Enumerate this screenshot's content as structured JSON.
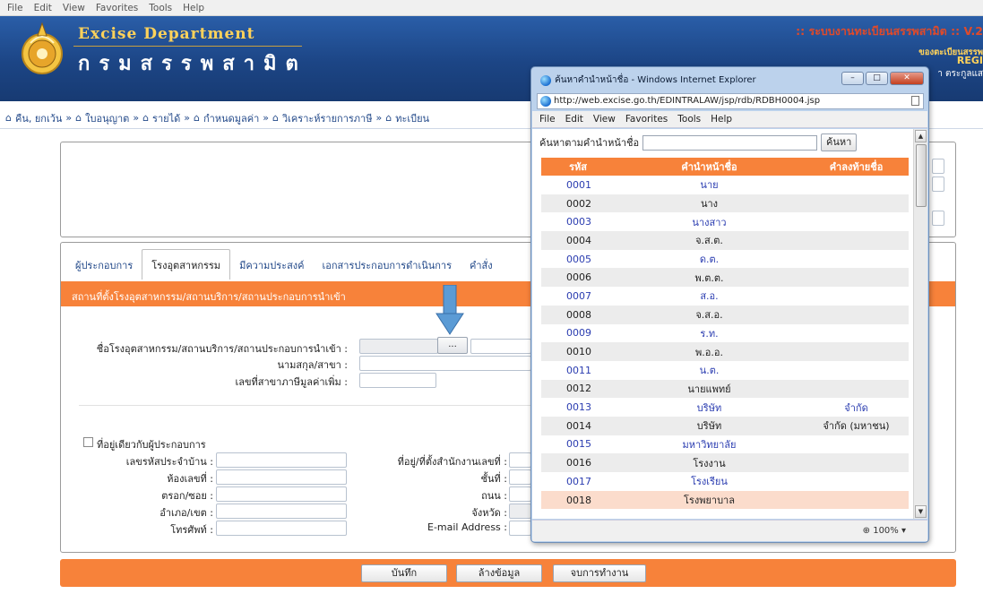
{
  "browser_menu": [
    "File",
    "Edit",
    "View",
    "Favorites",
    "Tools",
    "Help"
  ],
  "header": {
    "brand_en": "Excise Department",
    "brand_th": "กรมสรรพสามิต",
    "system_title": ":: ระบบงานทะเบียนสรรพสามิต :: V.2",
    "sub1": "ของตะเบียนสรรพ",
    "sub2": "REGI",
    "sub3": "า ตระกูลแส"
  },
  "breadcrumbs": [
    "คืน, ยกเว้น",
    "ใบอนุญาต",
    "รายได้",
    "กำหนดมูลค่า",
    "วิเคราะห์รายการภาษี",
    "ทะเบียน"
  ],
  "tabs": [
    "ผู้ประกอบการ",
    "โรงอุตสาหกรรม",
    "มีความประสงค์",
    "เอกสารประกอบการดำเนินการ",
    "คำสั่ง"
  ],
  "active_tab": "โรงอุตสาหกรรม",
  "section_title": "สถานที่ตั้งโรงอุตสาหกรรม/สถานบริการ/สถานประกอบการนำเข้า",
  "form": {
    "factory_name_label": "ชื่อโรงอุตสาหกรรม/สถานบริการ/สถานประกอบการนำเข้า :",
    "surname_label": "นามสกุล/สาขา :",
    "vat_branch_label": "เลขที่สาขาภาษีมูลค่าเพิ่ม :",
    "lookup_button": "...",
    "same_address_label": "ที่อยู่เดียวกับผู้ประกอบการ",
    "house_code_label": "เลขรหัสประจำบ้าน :",
    "room_label": "ห้องเลขที่ :",
    "soi_label": "ตรอก/ซอย :",
    "amphoe_label": "อำเภอ/เขต :",
    "phone_label": "โทรศัพท์ :",
    "office_address_label": "ที่อยู่/ที่ตั้งสำนักงานเลขที่ :",
    "floor_label": "ชั้นที่ :",
    "road_label": "ถนน :",
    "province_label": "จังหวัด :",
    "email_label": "E-mail Address :"
  },
  "buttons": {
    "save": "บันทึก",
    "clear": "ล้างข้อมูล",
    "finish": "จบการทำงาน"
  },
  "popup": {
    "title": "ค้นหาคำนำหน้าชื่อ - Windows Internet Explorer",
    "url": "http://web.excise.go.th/EDINTRALAW/jsp/rdb/RDBH0004.jsp",
    "menu": [
      "File",
      "Edit",
      "View",
      "Favorites",
      "Tools",
      "Help"
    ],
    "search_label": "ค้นหาตามคำนำหน้าชื่อ",
    "search_value": "",
    "search_button": "ค้นหา",
    "columns": [
      "รหัส",
      "คำนำหน้าชื่อ",
      "คำลงท้ายชื่อ"
    ],
    "rows": [
      [
        "0001",
        "นาย",
        ""
      ],
      [
        "0002",
        "นาง",
        ""
      ],
      [
        "0003",
        "นางสาว",
        ""
      ],
      [
        "0004",
        "จ.ส.ต.",
        ""
      ],
      [
        "0005",
        "ด.ต.",
        ""
      ],
      [
        "0006",
        "พ.ต.ต.",
        ""
      ],
      [
        "0007",
        "ส.อ.",
        ""
      ],
      [
        "0008",
        "จ.ส.อ.",
        ""
      ],
      [
        "0009",
        "ร.ท.",
        ""
      ],
      [
        "0010",
        "พ.อ.อ.",
        ""
      ],
      [
        "0011",
        "น.ต.",
        ""
      ],
      [
        "0012",
        "นายแพทย์",
        ""
      ],
      [
        "0013",
        "บริษัท",
        "จำกัด"
      ],
      [
        "0014",
        "บริษัท",
        "จำกัด (มหาชน)"
      ],
      [
        "0015",
        "มหาวิทยาลัย",
        ""
      ],
      [
        "0016",
        "โรงงาน",
        ""
      ],
      [
        "0017",
        "โรงเรียน",
        ""
      ],
      [
        "0018",
        "โรงพยาบาล",
        ""
      ]
    ],
    "zoom": "100%"
  }
}
